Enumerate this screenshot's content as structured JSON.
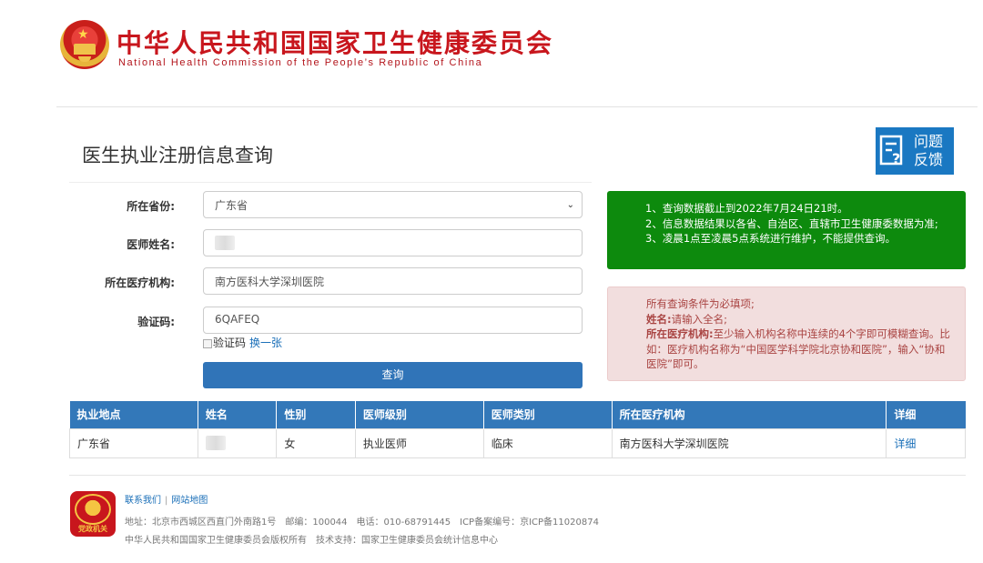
{
  "header": {
    "title_cn": "中华人民共和国国家卫生健康委员会",
    "title_en": "National Health Commission of the People’s Republic of China"
  },
  "page": {
    "title": "医生执业注册信息查询",
    "feedback_label": "问题\n反馈"
  },
  "form": {
    "province_label": "所在省份:",
    "province_value": "广东省",
    "name_label": "医师姓名:",
    "institution_label": "所在医疗机构:",
    "institution_value": "南方医科大学深圳医院",
    "captcha_label": "验证码:",
    "captcha_value": "6QAFEQ",
    "captcha_alt": "验证码",
    "captcha_refresh": "换一张",
    "submit_label": "查询"
  },
  "notice_green": {
    "lines": [
      "1、查询数据截止到2022年7月24日21时。",
      "2、信息数据结果以各省、自治区、直辖市卫生健康委数据为准;",
      "3、凌晨1点至凌晨5点系统进行维护，不能提供查询。"
    ]
  },
  "notice_red": {
    "line1": "所有查询条件为必填项;",
    "name_key": "姓名:",
    "name_tip": "请输入全名;",
    "inst_key": "所在医疗机构:",
    "inst_tip": "至少输入机构名称中连续的4个字即可模糊查询。比如：医疗机构名称为“中国医学科学院北京协和医院”，输入“协和医院”即可。"
  },
  "table": {
    "headers": [
      "执业地点",
      "姓名",
      "性别",
      "医师级别",
      "医师类别",
      "所在医疗机构",
      "详细"
    ],
    "rows": [
      [
        "广东省",
        "",
        "女",
        "执业医师",
        "临床",
        "南方医科大学深圳医院",
        "详细"
      ]
    ]
  },
  "footer": {
    "contact": "联系我们",
    "sitemap": "网站地图",
    "badge": "党政机关",
    "address": "地址：北京市西城区西直门外南路1号　邮编：100044　电话：010-68791445　ICP备案编号：京ICP备11020874",
    "copyright": "中华人民共和国国家卫生健康委员会版权所有　技术支持：国家卫生健康委员会统计信息中心"
  },
  "colors": {
    "brand_red": "#c8161d",
    "primary_blue": "#3074b8",
    "notice_green": "#0d8a0d",
    "notice_red_bg": "#f2dede"
  },
  "icons": [
    "national-emblem-icon",
    "feedback-icon",
    "select-chevron-icon",
    "broken-image-icon",
    "party-badge-icon"
  ]
}
